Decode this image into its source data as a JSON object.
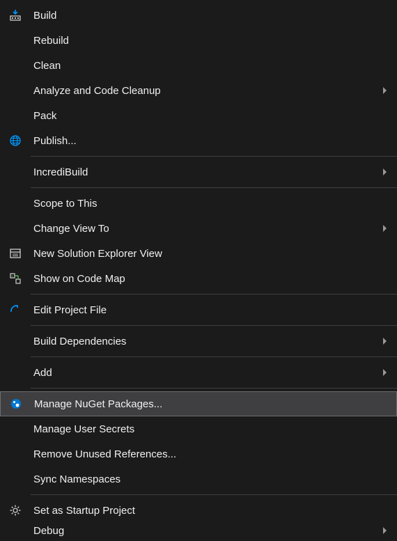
{
  "menu": {
    "items": [
      {
        "id": "build",
        "label": "Build",
        "icon": "build-icon",
        "submenu": false
      },
      {
        "id": "rebuild",
        "label": "Rebuild",
        "icon": null,
        "submenu": false
      },
      {
        "id": "clean",
        "label": "Clean",
        "icon": null,
        "submenu": false
      },
      {
        "id": "analyze",
        "label": "Analyze and Code Cleanup",
        "icon": null,
        "submenu": true
      },
      {
        "id": "pack",
        "label": "Pack",
        "icon": null,
        "submenu": false
      },
      {
        "id": "publish",
        "label": "Publish...",
        "icon": "globe-icon",
        "submenu": false
      },
      {
        "sep": true
      },
      {
        "id": "incredibuild",
        "label": "IncrediBuild",
        "icon": null,
        "submenu": true
      },
      {
        "sep": true
      },
      {
        "id": "scope",
        "label": "Scope to This",
        "icon": null,
        "submenu": false
      },
      {
        "id": "changeview",
        "label": "Change View To",
        "icon": null,
        "submenu": true
      },
      {
        "id": "newsolution",
        "label": "New Solution Explorer View",
        "icon": "window-icon",
        "submenu": false
      },
      {
        "id": "codemap",
        "label": "Show on Code Map",
        "icon": "codemap-icon",
        "submenu": false
      },
      {
        "sep": true
      },
      {
        "id": "editproj",
        "label": "Edit Project File",
        "icon": "edit-icon",
        "submenu": false
      },
      {
        "sep": true
      },
      {
        "id": "builddeps",
        "label": "Build Dependencies",
        "icon": null,
        "submenu": true
      },
      {
        "sep": true
      },
      {
        "id": "add",
        "label": "Add",
        "icon": null,
        "submenu": true
      },
      {
        "sep": true
      },
      {
        "id": "nuget",
        "label": "Manage NuGet Packages...",
        "icon": "nuget-icon",
        "submenu": false,
        "selected": true
      },
      {
        "id": "usersecrets",
        "label": "Manage User Secrets",
        "icon": null,
        "submenu": false
      },
      {
        "id": "removeunused",
        "label": "Remove Unused References...",
        "icon": null,
        "submenu": false
      },
      {
        "id": "syncns",
        "label": "Sync Namespaces",
        "icon": null,
        "submenu": false
      },
      {
        "sep": true
      },
      {
        "id": "startup",
        "label": "Set as Startup Project",
        "icon": "gear-icon",
        "submenu": false
      },
      {
        "id": "debug",
        "label": "Debug",
        "icon": null,
        "submenu": true
      }
    ]
  },
  "colors": {
    "accent_blue": "#0099ff",
    "bg": "#1b1b1c",
    "selected_bg": "#3f3f41",
    "selected_border": "#6d6d70"
  }
}
